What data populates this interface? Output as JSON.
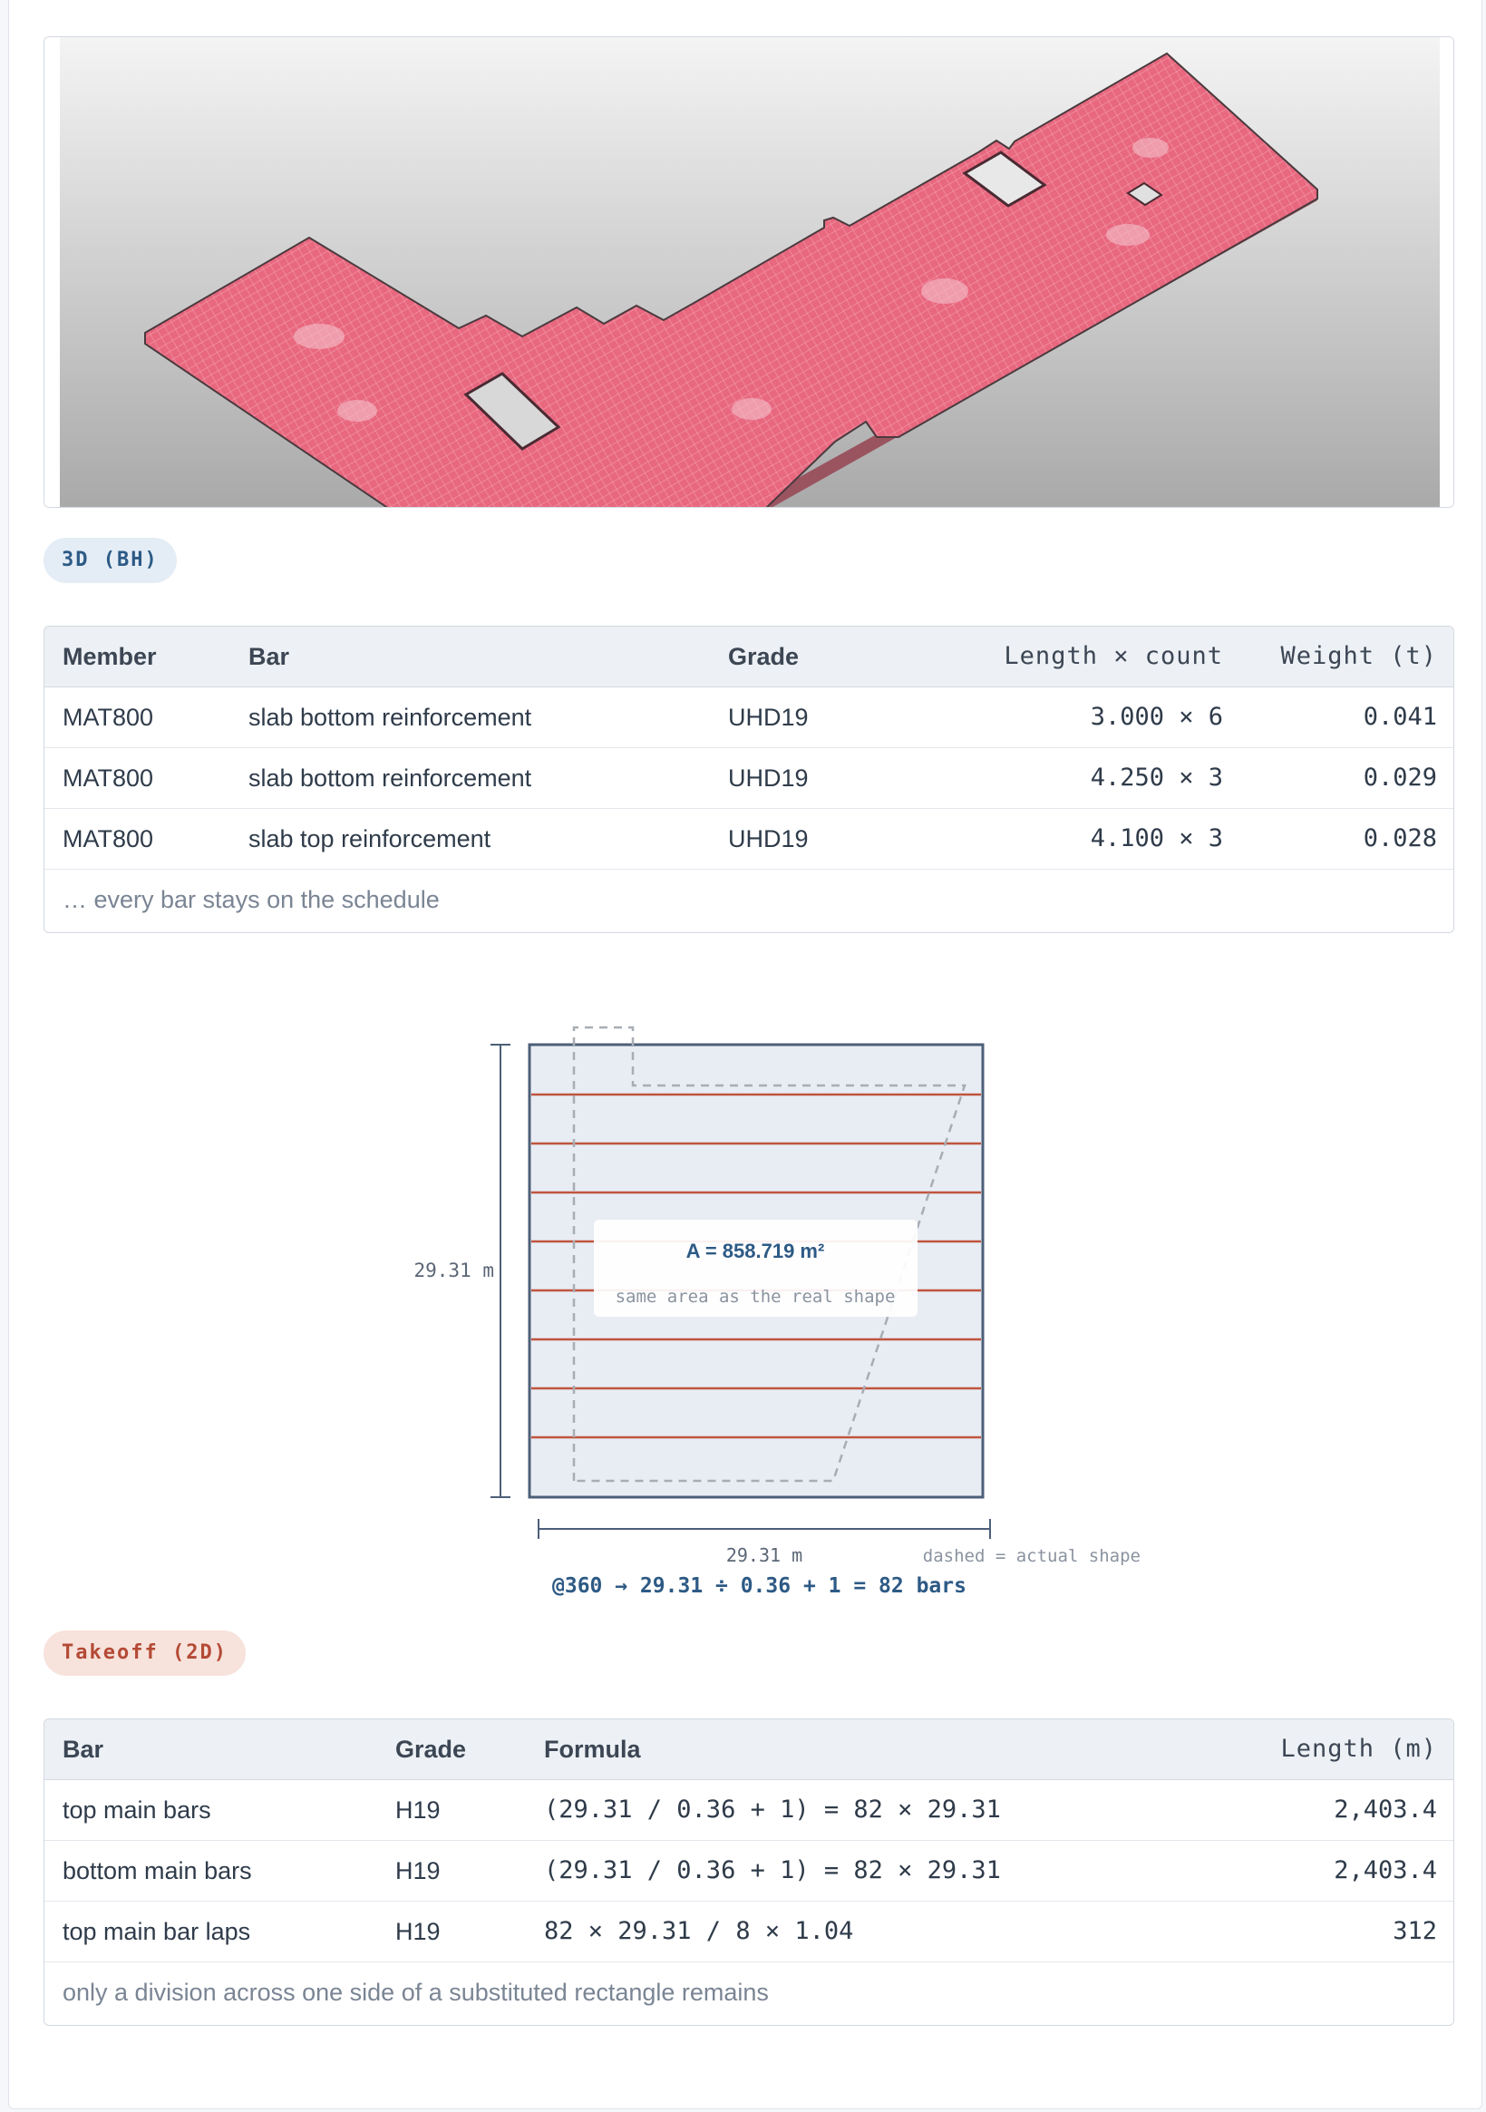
{
  "viewer": {
    "badge": "3D (BH)"
  },
  "schedule": {
    "columns": [
      "Member",
      "Bar",
      "Grade",
      "Length × count",
      "Weight (t)"
    ],
    "rows": [
      {
        "member": "MAT800",
        "bar": "slab bottom reinforcement",
        "grade": "UHD19",
        "length_count": "3.000 × 6",
        "weight": "0.041"
      },
      {
        "member": "MAT800",
        "bar": "slab bottom reinforcement",
        "grade": "UHD19",
        "length_count": "4.250 × 3",
        "weight": "0.029"
      },
      {
        "member": "MAT800",
        "bar": "slab top reinforcement",
        "grade": "UHD19",
        "length_count": "4.100 × 3",
        "weight": "0.028"
      }
    ],
    "note": "… every bar stays on the schedule"
  },
  "diagram": {
    "height_label": "29.31 m",
    "width_label": "29.31 m",
    "area_label": "A = 858.719 m²",
    "area_sub": "same area as the real shape",
    "legend": "dashed = actual shape",
    "formula": "@360 → 29.31 ÷ 0.36 + 1 = 82 bars",
    "colors": {
      "rect_fill": "#e8edf4",
      "rect_stroke": "#4d5f78",
      "bars": "#c0553d",
      "dashed": "#a8adb4"
    }
  },
  "takeoff": {
    "badge": "Takeoff (2D)",
    "columns": [
      "Bar",
      "Grade",
      "Formula",
      "Length (m)"
    ],
    "rows": [
      {
        "bar": "top main bars",
        "grade": "H19",
        "formula": "(29.31 / 0.36 + 1) = 82 × 29.31",
        "length": "2,403.4"
      },
      {
        "bar": "bottom main bars",
        "grade": "H19",
        "formula": "(29.31 / 0.36 + 1) = 82 × 29.31",
        "length": "2,403.4"
      },
      {
        "bar": "top main bar laps",
        "grade": "H19",
        "formula": "82 × 29.31 / 8 × 1.04",
        "length": "312"
      }
    ],
    "note": "only a division across one side of a substituted rectangle remains"
  },
  "colors": {
    "slab": "#e8687f",
    "badge_blue": "#2d5a85",
    "badge_red": "#b44a35"
  }
}
